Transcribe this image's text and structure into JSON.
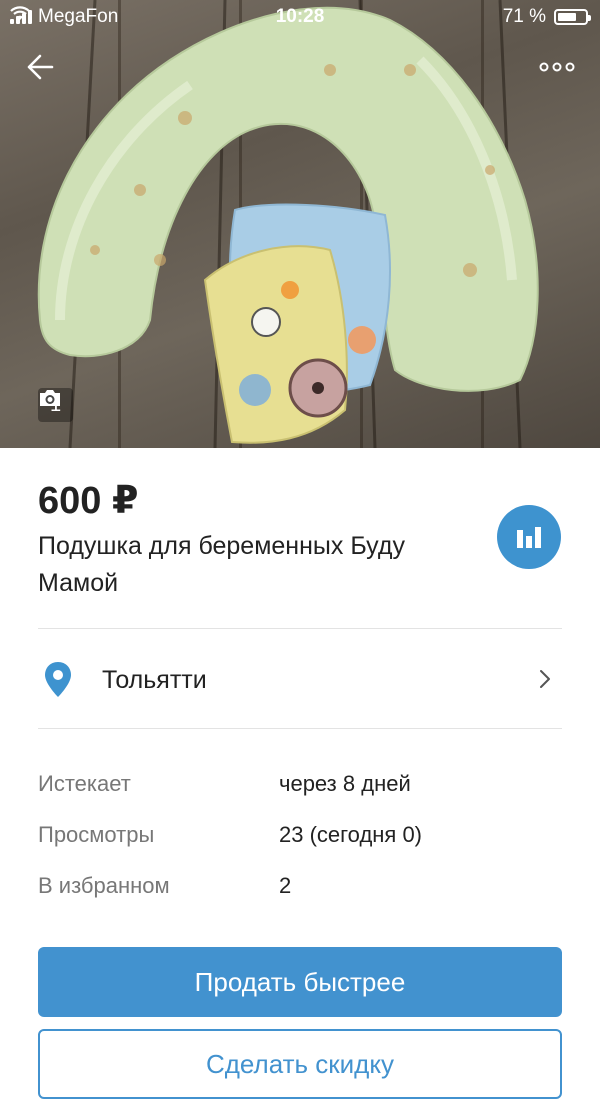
{
  "status_bar": {
    "carrier": "MegaFon",
    "time": "10:28",
    "battery": "71 %",
    "battery_level": 0.71
  },
  "photo": {
    "count": "1",
    "description_icons": [
      "camera-icon"
    ]
  },
  "listing": {
    "price": "600 ₽",
    "title": "Подушка для беременных Буду Мамой"
  },
  "location": {
    "city": "Тольятти"
  },
  "info": [
    {
      "label": "Истекает",
      "value": "через 8 дней"
    },
    {
      "label": "Просмотры",
      "value": "23 (сегодня 0)"
    },
    {
      "label": "В избранном",
      "value": "2"
    }
  ],
  "actions": {
    "sell_faster": "Продать быстрее",
    "make_discount": "Сделать скидку"
  },
  "colors": {
    "accent": "#4292cf",
    "stats_button": "#3e93cf",
    "pin": "#3e93cf"
  }
}
